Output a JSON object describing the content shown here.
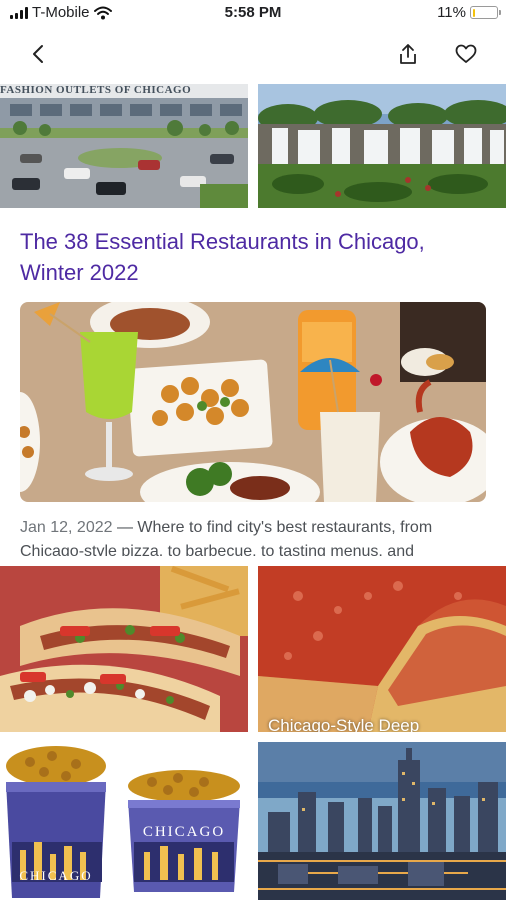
{
  "status_bar": {
    "carrier": "T-Mobile",
    "time": "5:58 PM",
    "battery_percent": "11%",
    "battery_level": 0.11
  },
  "nav": {
    "back_icon": "chevron-left-icon",
    "share_icon": "share-icon",
    "favorite_icon": "heart-outline-icon"
  },
  "top_images": {
    "left_sign_text": "FASHION OUTLETS OF CHICAGO"
  },
  "result": {
    "title": "The 38 Essential Restaurants in Chicago, Winter 2022",
    "date": "Jan 12, 2022",
    "snippet": " — Where to find city's best restaurants, from Chicago-style pizza, to barbecue, to tasting menus, and"
  },
  "grid": {
    "pizza_caption": "Chicago-Style Deep",
    "tin_label_1": "CHICAGO",
    "tin_label_2": "CHICAGO"
  }
}
